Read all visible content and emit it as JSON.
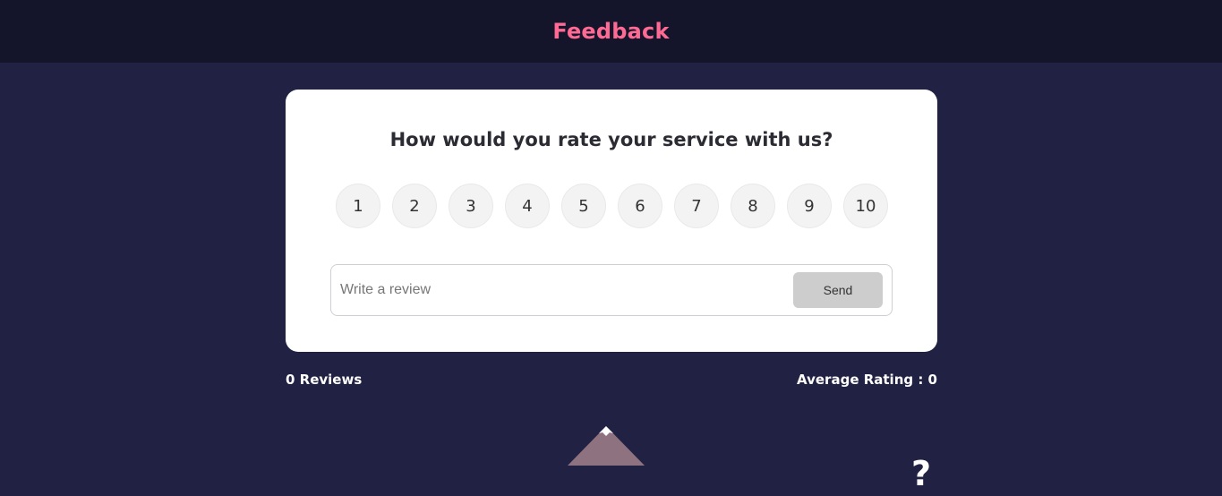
{
  "header": {
    "title": "Feedback"
  },
  "card": {
    "question": "How would you rate your service with us?",
    "ratings": [
      "1",
      "2",
      "3",
      "4",
      "5",
      "6",
      "7",
      "8",
      "9",
      "10"
    ],
    "review": {
      "placeholder": "Write a review",
      "value": ""
    },
    "send_label": "Send"
  },
  "stats": {
    "reviews": "0 Reviews",
    "average": "Average Rating : 0"
  },
  "help": {
    "label": "?"
  },
  "colors": {
    "header_bg": "#14152a",
    "page_bg": "#212143",
    "title": "#ff6a95",
    "mountain": "#8e727f"
  },
  "icons": {
    "decoration": "mountain-icon",
    "help": "question-mark-icon"
  }
}
